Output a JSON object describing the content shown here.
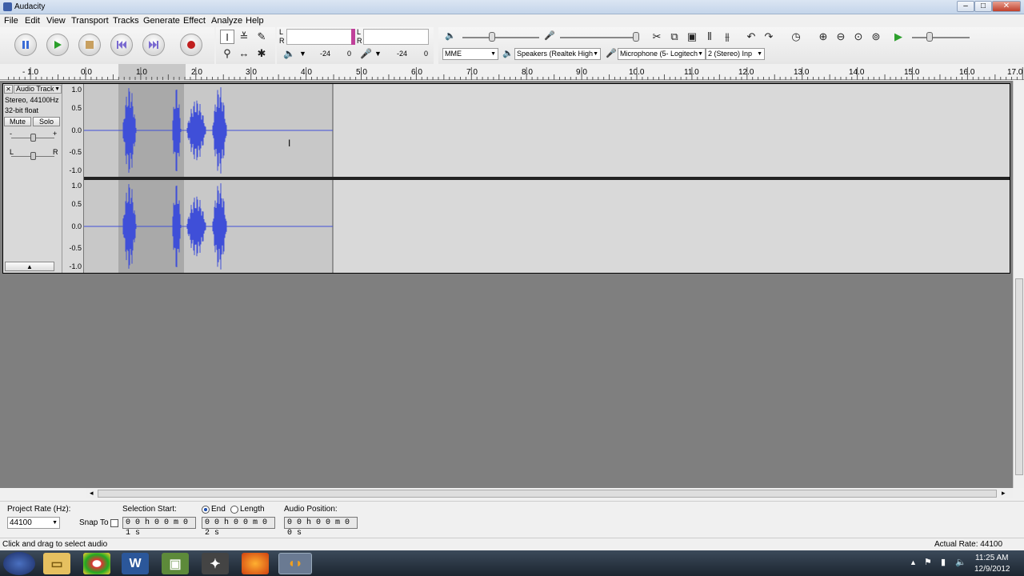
{
  "window": {
    "title": "Audacity",
    "minimize": "–",
    "maximize": "□",
    "close": "✕"
  },
  "menu": [
    "File",
    "Edit",
    "View",
    "Transport",
    "Tracks",
    "Generate",
    "Effect",
    "Analyze",
    "Help"
  ],
  "meters": {
    "playback_L": "L",
    "playback_R": "R",
    "record_L": "L",
    "record_R": "R",
    "level_a": "-24",
    "level_b": "0",
    "level_c": "-24",
    "level_d": "0"
  },
  "devices": {
    "host": "MME",
    "output": "Speakers (Realtek High",
    "input": "Microphone (5- Logitech",
    "channels": "2 (Stereo) Inp"
  },
  "ruler": [
    "- 1.0",
    "0.0",
    "1.0",
    "2.0",
    "3.0",
    "4.0",
    "5.0",
    "6.0",
    "7.0",
    "8.0",
    "9.0",
    "10.0",
    "11.0",
    "12.0",
    "13.0",
    "14.0",
    "15.0",
    "16.0",
    "17.0"
  ],
  "track": {
    "close": "✕",
    "name": "Audio Track",
    "info_rate": "Stereo, 44100Hz",
    "info_format": "32-bit float",
    "mute": "Mute",
    "solo": "Solo",
    "gain_minus": "-",
    "gain_plus": "+",
    "pan_left": "L",
    "pan_right": "R",
    "collapse": "▲",
    "vruler": [
      "1.0",
      "0.5",
      "0.0",
      "-0.5",
      "-1.0"
    ]
  },
  "selection_bar": {
    "project_rate_label": "Project Rate (Hz):",
    "project_rate": "44100",
    "snap_label": "Snap To",
    "selection_start_label": "Selection Start:",
    "end_label": "End",
    "length_label": "Length",
    "audio_position_label": "Audio Position:",
    "start_value": "0 0 h 0 0 m 0 1 s",
    "end_value": "0 0 h 0 0 m 0 2 s",
    "position_value": "0 0 h 0 0 m 0 0 s"
  },
  "status": {
    "message": "Click and drag to select audio",
    "actual_rate": "Actual Rate: 44100"
  },
  "taskbar": {
    "time": "11:25 AM",
    "date": "12/9/2012"
  },
  "colors": {
    "waveform": "#3f4fd8",
    "selection": "#a9a9a9",
    "track_bg": "#d9d9d9",
    "empty_area": "#7f7f7f"
  }
}
